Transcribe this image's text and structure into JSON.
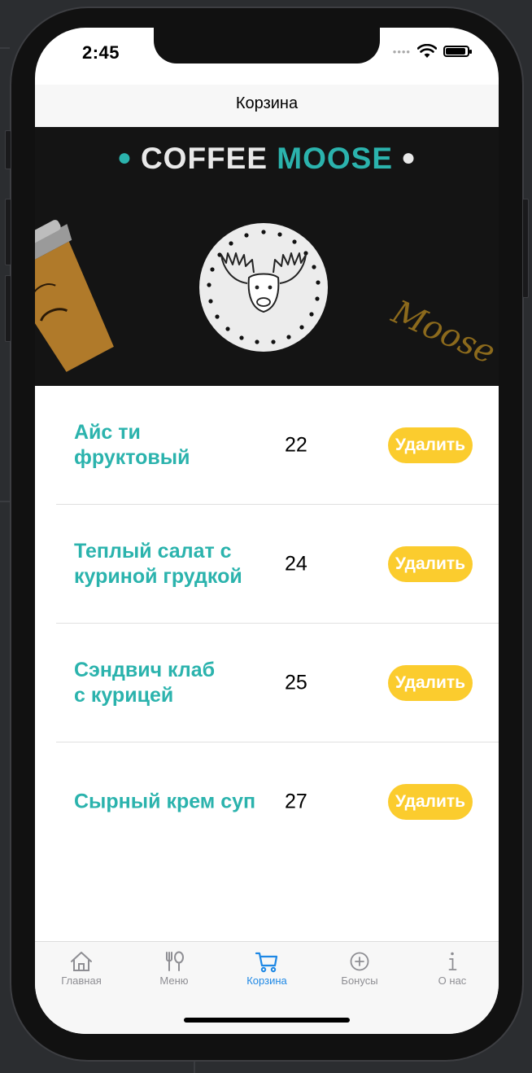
{
  "status": {
    "time": "2:45"
  },
  "nav": {
    "title": "Корзина"
  },
  "banner": {
    "brand_word1": "COFFEE",
    "brand_word2": "MOOSE"
  },
  "cart": {
    "items": [
      {
        "name_line1": "Айс ти",
        "name_line2": "фруктовый",
        "qty": "22",
        "delete_label": "Удалить"
      },
      {
        "name_line1": "Теплый салат с",
        "name_line2": "куриной грудкой",
        "qty": "24",
        "delete_label": "Удалить"
      },
      {
        "name_line1": "Сэндвич клаб",
        "name_line2": "с курицей",
        "qty": "25",
        "delete_label": "Удалить"
      },
      {
        "name_line1": "Сырный крем суп",
        "name_line2": "",
        "qty": "27",
        "delete_label": "Удалить"
      }
    ]
  },
  "tabbar": {
    "active_color": "#1e88e5",
    "tabs": [
      {
        "label": "Главная",
        "icon": "house-icon"
      },
      {
        "label": "Меню",
        "icon": "fork-knife-icon"
      },
      {
        "label": "Корзина",
        "icon": "cart-icon"
      },
      {
        "label": "Бонусы",
        "icon": "plus-circle-icon"
      },
      {
        "label": "О нас",
        "icon": "info-icon"
      }
    ]
  },
  "colors": {
    "accent": "#2bb3ad",
    "delete_button": "#fbcc2e",
    "banner_bg": "#141414"
  }
}
